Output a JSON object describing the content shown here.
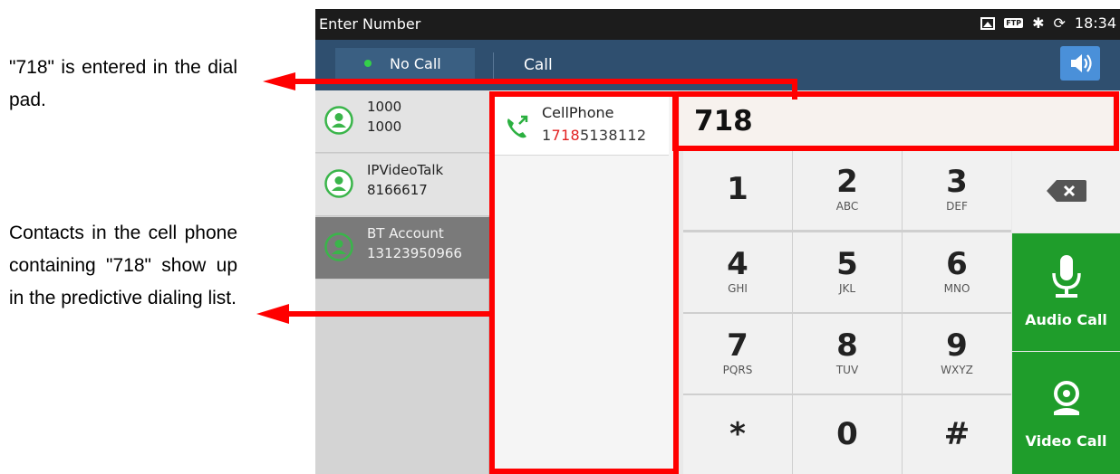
{
  "annotations": {
    "dial_pad_note": "\"718\" is entered in the dial pad.",
    "predictive_note": "Contacts in the cell phone containing \"718\" show up in the predictive dialing list."
  },
  "statusbar": {
    "title": "Enter Number",
    "time": "18:34",
    "icons": [
      "image-icon",
      "ftp-icon",
      "bluetooth-icon",
      "sync-icon"
    ]
  },
  "header": {
    "status_tab": "No Call",
    "call_tab": "Call",
    "speaker_icon": "speaker-icon"
  },
  "contacts": [
    {
      "name": "1000",
      "number": "1000"
    },
    {
      "name": "IPVideoTalk",
      "number": "8166617"
    },
    {
      "name": "BT Account",
      "number": "13123950966"
    }
  ],
  "predictive": {
    "name": "CellPhone",
    "number_prefix": "1",
    "number_match": "718",
    "number_suffix": "5138112"
  },
  "dial": {
    "entered": "718"
  },
  "keypad": [
    {
      "digit": "1",
      "letters": ""
    },
    {
      "digit": "2",
      "letters": "ABC"
    },
    {
      "digit": "3",
      "letters": "DEF"
    },
    {
      "digit": "4",
      "letters": "GHI"
    },
    {
      "digit": "5",
      "letters": "JKL"
    },
    {
      "digit": "6",
      "letters": "MNO"
    },
    {
      "digit": "7",
      "letters": "PQRS"
    },
    {
      "digit": "8",
      "letters": "TUV"
    },
    {
      "digit": "9",
      "letters": "WXYZ"
    },
    {
      "digit": "*",
      "letters": ""
    },
    {
      "digit": "0",
      "letters": ""
    },
    {
      "digit": "#",
      "letters": ""
    }
  ],
  "actions": {
    "audio_call": "Audio Call",
    "video_call": "Video Call"
  },
  "colors": {
    "highlight": "#ff0000",
    "call_green": "#1f9d2b",
    "header_blue": "#2f4f6f",
    "match_red": "#e22020"
  }
}
